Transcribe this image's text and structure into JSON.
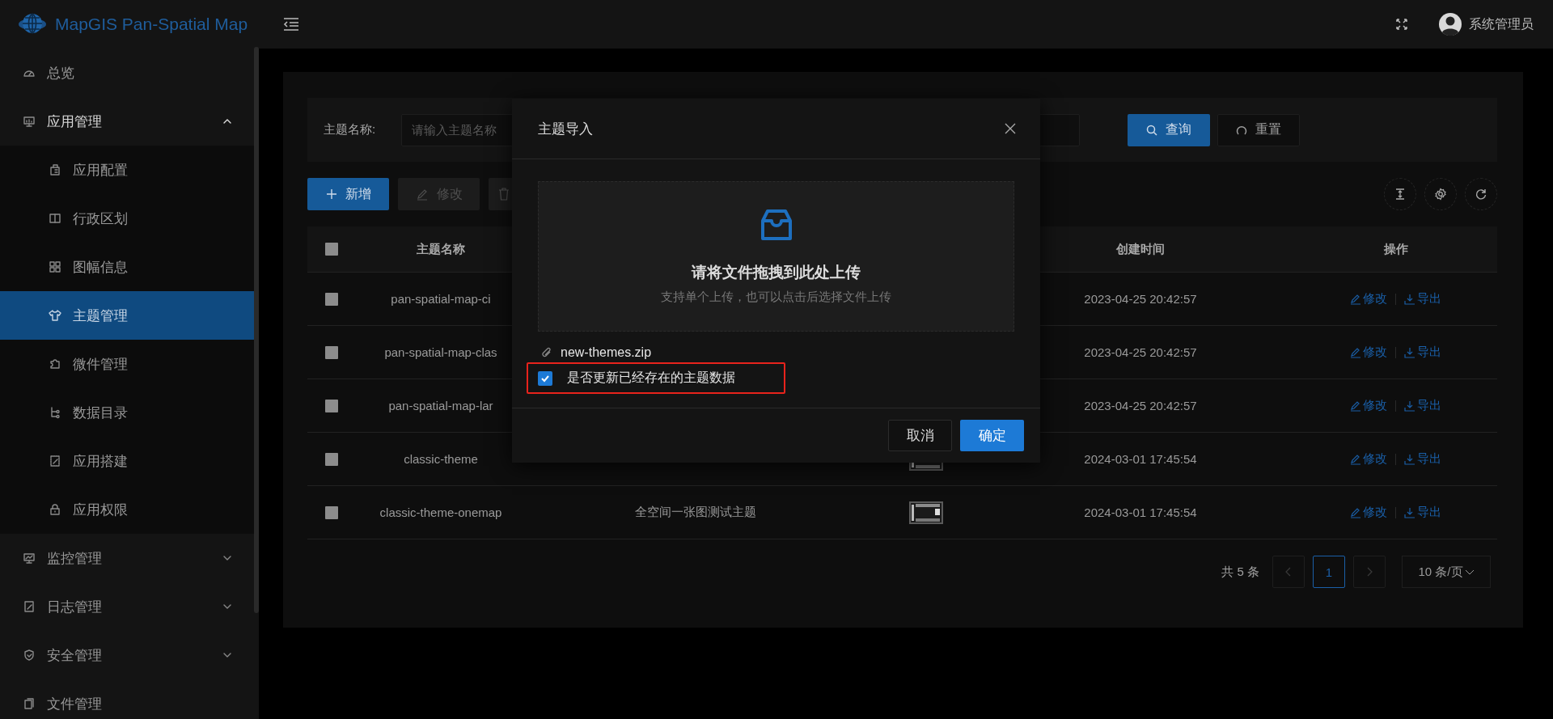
{
  "brand": {
    "title": "MapGIS Pan-Spatial Map"
  },
  "header": {
    "user": "系统管理员"
  },
  "sidebar": {
    "items": [
      {
        "label": "总览",
        "kind": "link",
        "selected": false
      },
      {
        "label": "应用管理",
        "kind": "group",
        "selected": false,
        "expanded": true,
        "children": [
          {
            "label": "应用配置",
            "selected": false
          },
          {
            "label": "行政区划",
            "selected": false
          },
          {
            "label": "图幅信息",
            "selected": false
          },
          {
            "label": "主题管理",
            "selected": true
          },
          {
            "label": "微件管理",
            "selected": false
          },
          {
            "label": "数据目录",
            "selected": false
          },
          {
            "label": "应用搭建",
            "selected": false
          },
          {
            "label": "应用权限",
            "selected": false
          }
        ]
      },
      {
        "label": "监控管理",
        "kind": "group",
        "selected": false,
        "expanded": false
      },
      {
        "label": "日志管理",
        "kind": "group",
        "selected": false,
        "expanded": false
      },
      {
        "label": "安全管理",
        "kind": "group",
        "selected": false,
        "expanded": false
      },
      {
        "label": "文件管理",
        "kind": "link",
        "selected": false
      }
    ]
  },
  "search": {
    "label": "主题名称:",
    "placeholder": "请输入主题名称",
    "buttons": [
      {
        "label": "查询",
        "kind": "primary"
      },
      {
        "label": "重置",
        "kind": "default"
      }
    ]
  },
  "toolbar": {
    "buttons": [
      {
        "label": "新增",
        "kind": "add",
        "disabled": false
      },
      {
        "label": "修改",
        "kind": "edit",
        "disabled": true
      },
      {
        "kind": "delete",
        "disabled": true
      }
    ]
  },
  "table": {
    "select_all": {
      "checked": false
    },
    "columns": {
      "name": "主题名称",
      "created": "创建时间",
      "actions": "操作"
    },
    "rows": [
      {
        "checked": false,
        "name": "pan-spatial-map-ci",
        "created": "2023-04-25 20:42:57",
        "actions": [
          {
            "label": "修改",
            "kind": "edit"
          },
          {
            "label": "导出",
            "kind": "export"
          }
        ]
      },
      {
        "checked": false,
        "name": "pan-spatial-map-clas",
        "created": "2023-04-25 20:42:57",
        "actions": [
          {
            "label": "修改",
            "kind": "edit"
          },
          {
            "label": "导出",
            "kind": "export"
          }
        ]
      },
      {
        "checked": false,
        "name": "pan-spatial-map-lar",
        "created": "2023-04-25 20:42:57",
        "actions": [
          {
            "label": "修改",
            "kind": "edit"
          },
          {
            "label": "导出",
            "kind": "export"
          }
        ]
      },
      {
        "checked": false,
        "name": "classic-theme",
        "thumbnail": {
          "kind": "picture"
        },
        "created": "2024-03-01 17:45:54",
        "actions": [
          {
            "label": "修改",
            "kind": "edit"
          },
          {
            "label": "导出",
            "kind": "export"
          }
        ]
      },
      {
        "checked": false,
        "name": "classic-theme-onemap",
        "description": "全空间一张图测试主题",
        "thumbnail": {
          "kind": "picture"
        },
        "created": "2024-03-01 17:45:54",
        "actions": [
          {
            "label": "修改",
            "kind": "edit"
          },
          {
            "label": "导出",
            "kind": "export"
          }
        ]
      }
    ]
  },
  "pagination": {
    "total": "共 5 条",
    "prev": {
      "disabled": true
    },
    "pages": [
      {
        "label": "1",
        "selected": true
      }
    ],
    "next": {
      "disabled": true
    },
    "page_size": "10 条/页"
  },
  "modal": {
    "title": "主题导入",
    "upload": {
      "title": "请将文件拖拽到此处上传",
      "hint": "支持单个上传，也可以点击后选择文件上传"
    },
    "files": [
      {
        "name": "new-themes.zip"
      }
    ],
    "options": [
      {
        "label": "是否更新已经存在的主题数据",
        "checked": true,
        "highlighted": true
      }
    ],
    "buttons": [
      {
        "label": "取消",
        "kind": "default"
      },
      {
        "label": "确定",
        "kind": "primary"
      }
    ]
  }
}
